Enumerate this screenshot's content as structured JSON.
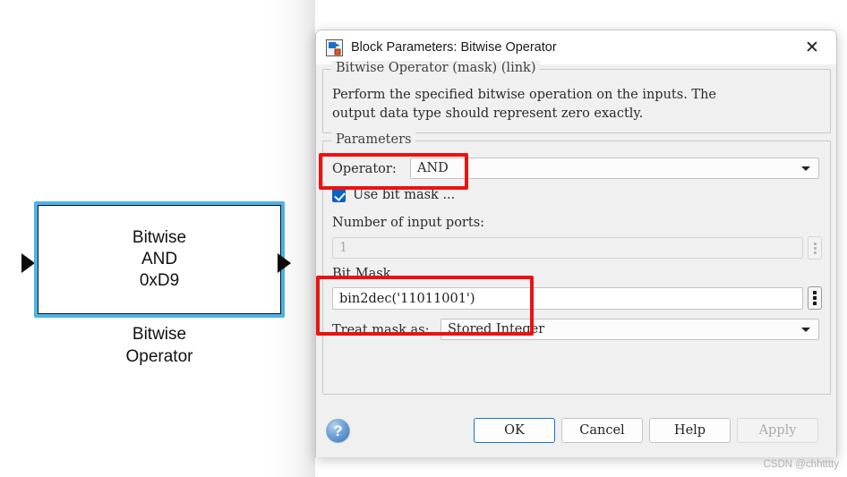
{
  "canvas": {
    "block": {
      "label_lines": "Bitwise\nAND\n0xD9",
      "caption": "Bitwise\nOperator",
      "selection_color": "#4BB4EA",
      "input_port_icon": "triangle-right-icon",
      "output_port_icon": "triangle-right-icon"
    }
  },
  "dialog": {
    "title": "Block Parameters: Bitwise Operator",
    "app_icon": "simulink-block-icon",
    "close_icon": "✕",
    "description": {
      "legend": "Bitwise Operator (mask) (link)",
      "text": "Perform the specified bitwise operation on the inputs. The\noutput data type should represent zero exactly."
    },
    "parameters": {
      "legend": "Parameters",
      "operator": {
        "label": "Operator:",
        "value": "AND",
        "caret_icon": "chevron-down-icon"
      },
      "use_bit_mask": {
        "label": "Use bit mask ...",
        "checked": true,
        "check_icon": "checkmark-icon"
      },
      "number_of_input_ports": {
        "label": "Number of input ports:",
        "value": "1",
        "enabled": false,
        "more_icon": "vertical-ellipsis-icon"
      },
      "bit_mask": {
        "label": "Bit Mask",
        "value": "bin2dec('11011001')",
        "more_icon": "vertical-ellipsis-icon"
      },
      "treat_mask_as": {
        "label": "Treat mask as:",
        "value": "Stored Integer",
        "caret_icon": "chevron-down-icon"
      }
    },
    "footer": {
      "help_icon": "?",
      "ok": "OK",
      "cancel": "Cancel",
      "help": "Help",
      "apply": "Apply"
    }
  },
  "annotations": {
    "highlight_color": "#ee1111",
    "boxes": [
      "operator-row",
      "bit-mask-row"
    ]
  },
  "watermark": "CSDN @chhtttty"
}
